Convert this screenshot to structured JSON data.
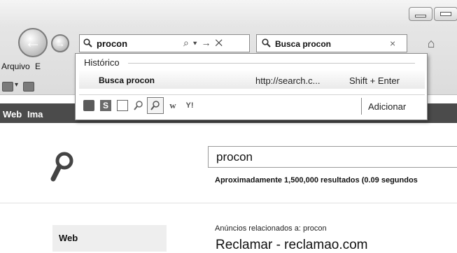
{
  "address_bar": {
    "value": "procon",
    "controls": "⌕ ▾ → ✕"
  },
  "tab": {
    "title": "Busca procon",
    "close": "×"
  },
  "menu": {
    "items": [
      "Arquivo",
      "E"
    ]
  },
  "dropdown": {
    "header": "Histórico",
    "entry": {
      "title": "Busca procon",
      "url": "http://search.c...",
      "shortcut": "Shift + Enter"
    },
    "providers": [
      "seal-icon",
      "S",
      "box-icon",
      "search-icon",
      "search-active-icon",
      "w",
      "Y!"
    ],
    "add_label": "Adicionar"
  },
  "nav_strip": {
    "items": [
      "Web",
      "Ima"
    ]
  },
  "search": {
    "value": "procon",
    "result_count": "Aproximadamente 1,500,000 resultados (0.09 segundos"
  },
  "sidebar": {
    "web_label": "Web"
  },
  "ads": {
    "label": "Anúncios relacionados a: procon",
    "first_title": "Reclamar - reclamao.com"
  },
  "colors": {
    "nav_strip_bg": "#4b4b4b",
    "chrome_bg": "#e2e2e2"
  }
}
